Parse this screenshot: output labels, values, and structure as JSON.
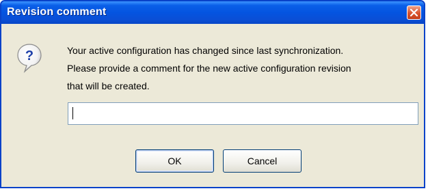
{
  "window": {
    "title": "Revision comment",
    "close_icon": "close-icon"
  },
  "message": {
    "icon": "question-icon",
    "lines": [
      "Your active configuration has changed since last synchronization.",
      "Please provide a comment for the new active configuration revision",
      "that will be created."
    ]
  },
  "comment_input": {
    "value": "",
    "placeholder": ""
  },
  "buttons": {
    "ok_label": "OK",
    "cancel_label": "Cancel"
  },
  "colors": {
    "titlebar": "#0454e0",
    "client_background": "#ece9d8",
    "close_button": "#d9532d"
  }
}
